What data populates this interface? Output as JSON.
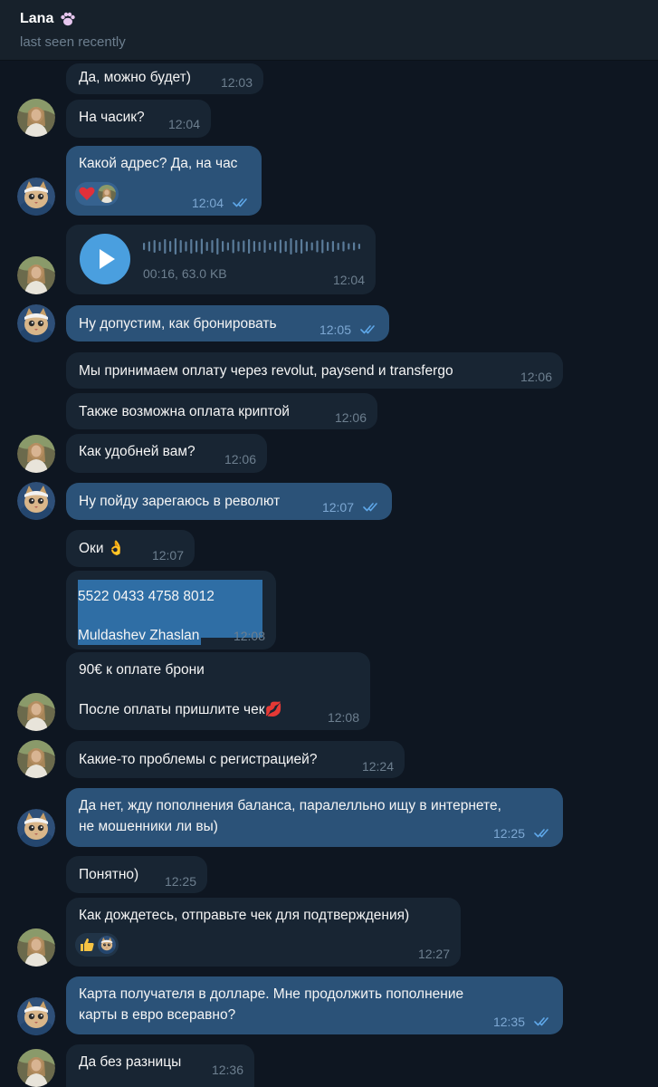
{
  "header": {
    "name": "Lana",
    "status": "last seen recently"
  },
  "messages": {
    "m1": {
      "text": "Да, можно будет)",
      "time": "12:03"
    },
    "m2": {
      "text": "На часик?",
      "time": "12:04"
    },
    "m3": {
      "text": "Какой адрес? Да, на час",
      "time": "12:04"
    },
    "m4": {
      "meta": "00:16, 63.0 KB",
      "time": "12:04"
    },
    "m5": {
      "text": "Ну допустим, как бронировать",
      "time": "12:05"
    },
    "m6": {
      "text": "Мы принимаем оплату через revolut, paysend и transfergo",
      "time": "12:06"
    },
    "m7": {
      "text": "Также возможна оплата криптой",
      "time": "12:06"
    },
    "m8": {
      "text": "Как удобней вам?",
      "time": "12:06"
    },
    "m9": {
      "text": "Ну пойду зарегаюсь в револют",
      "time": "12:07"
    },
    "m10": {
      "text": "Оки 👌",
      "time": "12:07"
    },
    "m11": {
      "line1": "5522 0433 4758 8012",
      "line2": "Muldashev Zhaslan",
      "time": "12:08"
    },
    "m12": {
      "line1": "90€ к оплате брони",
      "line2": "После оплаты пришлите чек💋",
      "time": "12:08"
    },
    "m13": {
      "text": "Какие-то проблемы с регистрацией?",
      "time": "12:24"
    },
    "m14": {
      "line1": "Да нет, жду пополнения баланса, паралелльно ищу в интернете,",
      "line2": "не мошенники ли вы)",
      "time": "12:25"
    },
    "m15": {
      "text": "Понятно)",
      "time": "12:25"
    },
    "m16": {
      "text": "Как дождетесь, отправьте чек для подтверждения)",
      "time": "12:27"
    },
    "m17": {
      "line1": "Карта получателя в долларе. Мне продолжить пополнение",
      "line2": "карты в евро всеравно?",
      "time": "12:35"
    },
    "m18": {
      "text": "Да без разницы",
      "time": "12:36"
    }
  },
  "colors": {
    "background": "#0e1621",
    "incoming": "#182533",
    "outgoing": "#2b5278",
    "accent": "#5ea7e8"
  }
}
